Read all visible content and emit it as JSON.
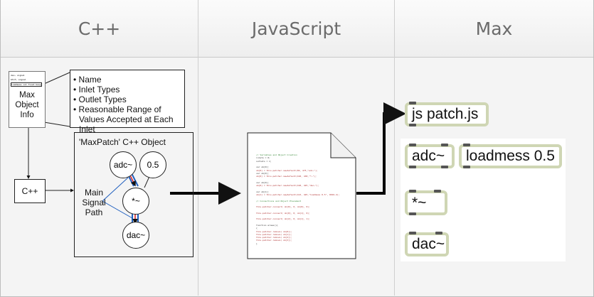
{
  "headers": {
    "cpp": "C++",
    "js": "JavaScript",
    "max": "Max"
  },
  "max_info": {
    "label": "Max Object Info",
    "thumb_lines": [
      "dac~ signal",
      "mtof~ signal",
      "loadmess int float bang"
    ],
    "bullets": [
      "Name",
      "Inlet Types",
      "Outlet Types",
      "Reasonable Range of Values Accepted at Each Inlet"
    ]
  },
  "cpp_box": {
    "label": "C++"
  },
  "maxpatch": {
    "title": "'MaxPatch' C++ Object",
    "nodes": {
      "adc": "adc~",
      "num": "0.5",
      "mul": "*~",
      "dac": "dac~"
    },
    "signal_label": "Main Signal Path"
  },
  "js_doc": {
    "lines": [
      {
        "t": "// Variables and Object Creation",
        "c": "#3a8a3a"
      },
      {
        "t": "inlets = 0;",
        "c": "#333"
      },
      {
        "t": "outlets = 1;",
        "c": "#333"
      },
      {
        "t": "",
        "c": "#333"
      },
      {
        "t": "var ob[0];",
        "c": "#333"
      },
      {
        "t": "ob[0] = this.patcher.newdefault(89, 475,\"adc~\");",
        "c": "#b03030"
      },
      {
        "t": "var ob[0];",
        "c": "#333"
      },
      {
        "t": "ob[0] = this.patcher.newdefault(418, 438,\"*~\");",
        "c": "#b03030"
      },
      {
        "t": "",
        "c": "#333"
      },
      {
        "t": "var ob[0];",
        "c": "#333"
      },
      {
        "t": "ob[0] = this.patcher.newdefault(418, 425,\"dac~\");",
        "c": "#b03030"
      },
      {
        "t": "",
        "c": "#333"
      },
      {
        "t": "var ob[1];",
        "c": "#333"
      },
      {
        "t": "ob[1] = this.patcher.newdefault(413, 425,\"loadmess 0.5\", 0019.2);",
        "c": "#b03030"
      },
      {
        "t": "",
        "c": "#333"
      },
      {
        "t": "// Connections and Object Placement",
        "c": "#3a8a3a"
      },
      {
        "t": "",
        "c": "#333"
      },
      {
        "t": "this.patcher.connect( ob[0], 0, ob[0], 0);",
        "c": "#b03030"
      },
      {
        "t": "",
        "c": "#333"
      },
      {
        "t": "this.patcher.connect( ob[0], 0, ob[1], 0);",
        "c": "#b03030"
      },
      {
        "t": "",
        "c": "#333"
      },
      {
        "t": "this.patcher.connect( ob[2], 0, ob[1], 1);",
        "c": "#b03030"
      },
      {
        "t": "",
        "c": "#333"
      },
      {
        "t": "function erase(){",
        "c": "#333"
      },
      {
        "t": "{",
        "c": "#333"
      },
      {
        "t": "    this.patcher.remove( ob[0]);",
        "c": "#b03030"
      },
      {
        "t": "    this.patcher.remove( ob[1]);",
        "c": "#b03030"
      },
      {
        "t": "    this.patcher.remove( ob[2]);",
        "c": "#b03030"
      },
      {
        "t": "    this.patcher.remove( ob[3]);",
        "c": "#b03030"
      },
      {
        "t": "}",
        "c": "#333"
      }
    ]
  },
  "max_patch": {
    "js_obj": "js patch.js",
    "adc": "adc~",
    "loadmess": "loadmess 0.5",
    "mul": "*~",
    "dac": "dac~",
    "obj_border_color": "#cfd6b4",
    "signal_cord_color": "#9acd32"
  }
}
